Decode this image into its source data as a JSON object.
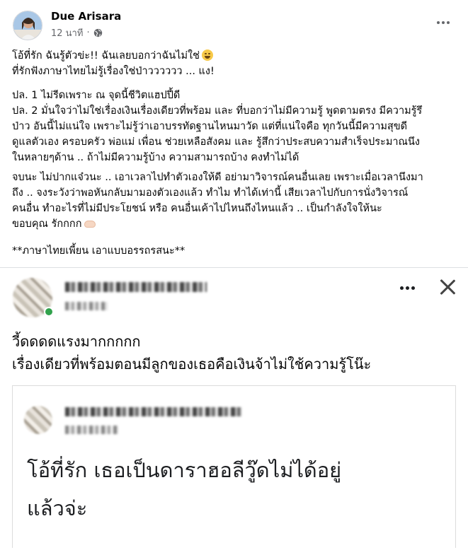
{
  "post": {
    "author": "Due Arisara",
    "time": "12 นาที",
    "caption": [
      "โอ้ที่รัก ฉันรู้ตัวข่ะ!! ฉันเลยบอกว่าฉันไม่ใช่",
      "ที่รักฟังภาษาไทยไม่รู้เรื่องใช่ป่าวววววว ... แง!",
      "ปล. 1 ไม่รีดเพราะ ณ จุดนี้ชีวิตแฮปปี้ดี",
      "ปล. 2 มั่นใจว่าไม่ใช่เรื่องเงินเรื่องเดียวที่พร้อม และ ที่บอกว่าไม่มีความรู้ พูดตามตรง มีความรู้รึ",
      "ป่าว อันนี้ไม่แน่ใจ เพราะไม่รู้ว่าเอาบรรทัดฐานไหนมาวัด แต่ที่แน่ใจคือ ทุกวันนี้มีความสุขดี",
      "ดูแลตัวเอง ครอบครัว พ่อแม่ เพื่อน ช่วยเหลือสังคม และ รู้สึกว่าประสบความสำเร็จประมาณนึง",
      "ในหลายๆด้าน .. ถ้าไม่มีความรู้บ้าง ความสามารถบ้าง คงทำไม่ได้",
      "จบนะ ไม่ปากแจ๋วนะ .. เอาเวลาไปทำตัวเองให้ดี อย่ามาวิจารณ์คนอื่นเลย เพราะเมื่อเวลานึงมา",
      "ถึง .. จงระวังว่าพอหันกลับมามองตัวเองแล้ว ทำไม ทำได้เท่านี้ เสียเวลาไปกับการนั่งวิจารณ์",
      "คนอื่น ทำอะไรที่ไม่มีประโยชน์ หรือ คนอื่นเค้าไปไหนถึงไหนแล้ว .. เป็นกำลังใจให้นะ",
      "ขอบคุณ รักกกก",
      "**ภาษาไทยเพี้ยน เอาแบบอรรถรสนะ**"
    ],
    "icons": {
      "emoji": "laughing-emoji",
      "heart_hands": "heart-hands-emoji",
      "privacy": "globe-icon",
      "more": "more-options-icon"
    }
  },
  "screenshot": {
    "comment_lines": [
      "วี้ดดดดแรงมากกกกก",
      "เรื่องเดียวที่พร้อมตอนมีลูกของเธอคือเงินจ้าไม่ใช้ความรู้โน๊ะ"
    ],
    "quoted_lines": [
      "โอ้ที่รัก เธอเป็นดาราฮอลีวู๊ดไม่ได้อยู่",
      "แล้วจ่ะ"
    ],
    "icons": {
      "more": "more-options-icon",
      "close": "close-icon"
    }
  }
}
